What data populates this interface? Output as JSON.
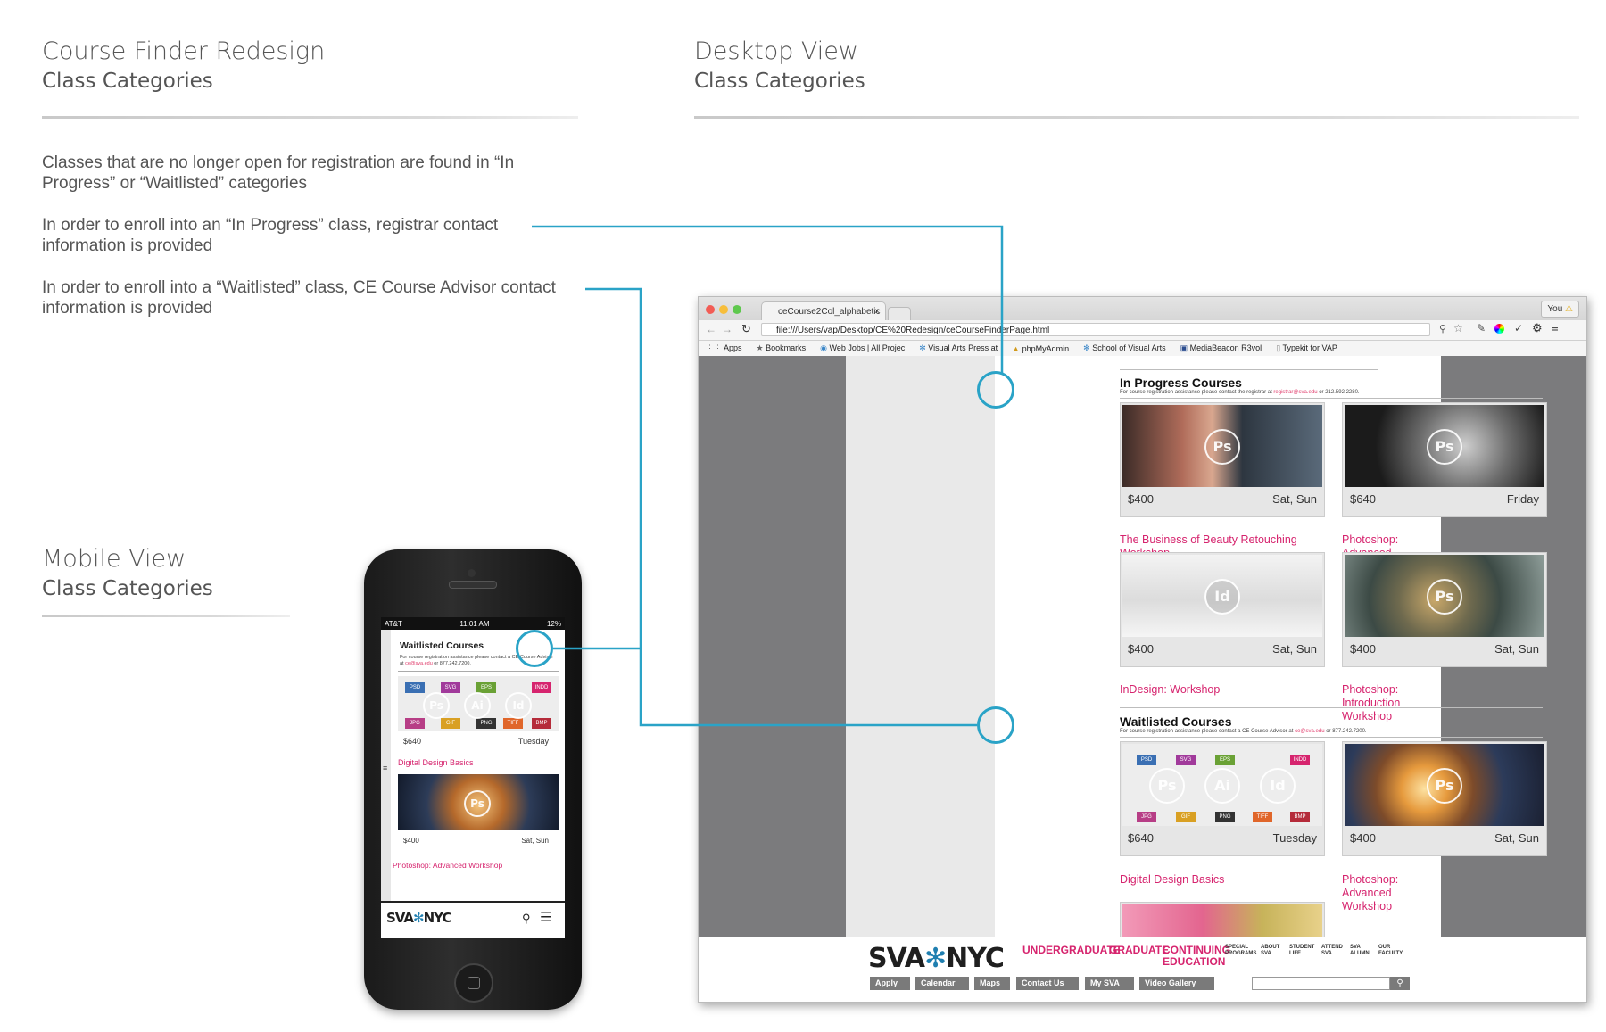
{
  "left_header": {
    "title": "Course Finder Redesign",
    "subtitle": "Class Categories"
  },
  "right_header": {
    "title": "Desktop View",
    "subtitle": "Class Categories"
  },
  "mobile_header": {
    "title": "Mobile View",
    "subtitle": "Class Categories"
  },
  "notes": [
    "Classes that are no longer open for registration are found in “In Progress” or “Waitlisted” categories",
    "In order to enroll into an “In Progress” class, registrar contact information is provided",
    "In order to enroll into a “Waitlisted” class, CE Course Advisor contact information is provided"
  ],
  "connector_color": "#2aa3c7",
  "mobile": {
    "status": {
      "carrier": "AT&T",
      "time": "11:01 AM",
      "battery": "12%"
    },
    "section_title": "Waitlisted Courses",
    "note_pre": "For course registration assistance please contact a CE Course Advisor at ",
    "note_email": "ce@sva.edu",
    "note_post": " or 877.242.7200.",
    "cards": [
      {
        "price": "$640",
        "days": "Tuesday",
        "title": "Digital Design Basics",
        "icons": [
          "Ps",
          "Ai",
          "Id"
        ]
      },
      {
        "price": "$400",
        "days": "Sat, Sun",
        "title": "Photoshop: Advanced Workshop",
        "icons": [
          "Ps"
        ]
      }
    ],
    "badges": [
      "PSD",
      "SVG",
      "EPS",
      "INDD",
      "JPG",
      "GIF",
      "PNG",
      "TIFF",
      "BMP"
    ],
    "logo_left": "SVA",
    "logo_right": "NYC"
  },
  "browser": {
    "tab_title": "ceCourse2Col_alphabetic",
    "tab_close": "×",
    "user_label": "You",
    "url": "file:///Users/vap/Desktop/CE%20Redesign/ceCourseFinderPage.html",
    "bookmarks": [
      "Apps",
      "Bookmarks",
      "Web Jobs | All Projec",
      "Visual Arts Press at",
      "phpMyAdmin",
      "School of Visual Arts",
      "MediaBeacon R3vol",
      "Typekit for VAP"
    ],
    "in_progress": {
      "title": "In Progress Courses",
      "note_pre": "For course registration assistance please contact the registrar at ",
      "note_email": "registrar@sva.edu",
      "note_post": " or 212.592.2280.",
      "cards": [
        {
          "price": "$400",
          "days": "Sat, Sun",
          "title": "The Business of Beauty Retouching Workshop",
          "icons": [
            "Ps"
          ]
        },
        {
          "price": "$640",
          "days": "Friday",
          "title": "Photoshop: Advanced Techniques",
          "icons": [
            "Ps"
          ]
        },
        {
          "price": "$400",
          "days": "Sat, Sun",
          "title": "InDesign: Workshop",
          "icons": [
            "Id"
          ]
        },
        {
          "price": "$400",
          "days": "Sat, Sun",
          "title": "Photoshop: Introduction Workshop",
          "icons": [
            "Ps"
          ]
        }
      ]
    },
    "waitlisted": {
      "title": "Waitlisted Courses",
      "note_pre": "For course registration assistance please contact a CE Course Advisor at ",
      "note_email": "ce@sva.edu",
      "note_post": " or 877.242.7200.",
      "cards": [
        {
          "price": "$640",
          "days": "Tuesday",
          "title": "Digital Design Basics",
          "icons": [
            "Ps",
            "Ai",
            "Id"
          ]
        },
        {
          "price": "$400",
          "days": "Sat, Sun",
          "title": "Photoshop: Advanced Workshop",
          "icons": [
            "Ps"
          ]
        }
      ]
    },
    "footer": {
      "logo_left": "SVA",
      "logo_right": "NYC",
      "nav": [
        "UNDERGRADUATE",
        "GRADUATE",
        "CONTINUING EDUCATION"
      ],
      "small_nav": [
        "SPECIAL PROGRAMS",
        "ABOUT SVA",
        "STUDENT LIFE",
        "ATTEND SVA",
        "SVA ALUMNI",
        "OUR FACULTY"
      ],
      "buttons": [
        "Apply",
        "Calendar",
        "Maps",
        "Contact Us",
        "My SVA",
        "Video Gallery"
      ]
    }
  }
}
